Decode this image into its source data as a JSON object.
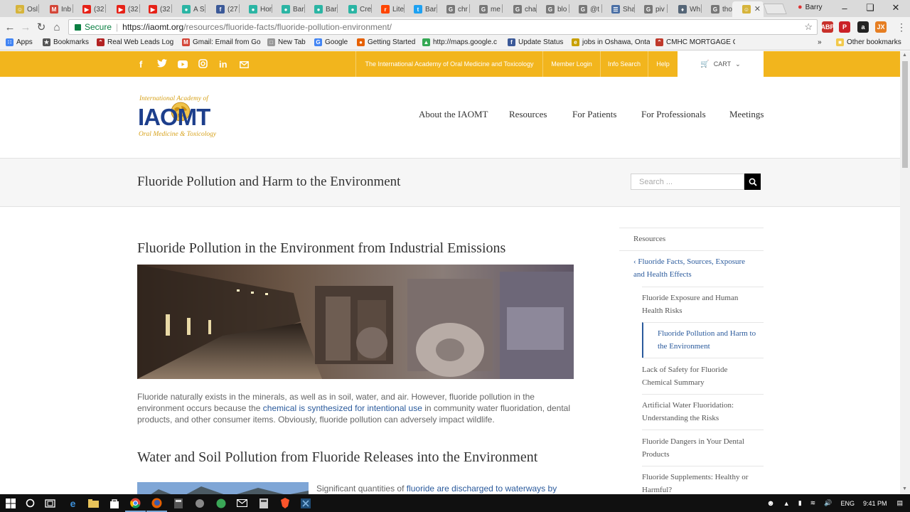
{
  "browser": {
    "tabs": [
      {
        "label": "Osl",
        "icon": "smiley-icon",
        "color": "#d6b43b"
      },
      {
        "label": "Inb",
        "icon": "gmail-icon",
        "color": "#d44638"
      },
      {
        "label": "(32",
        "icon": "youtube-icon",
        "color": "#e62117"
      },
      {
        "label": "(32",
        "icon": "youtube-icon",
        "color": "#e62117"
      },
      {
        "label": "(32",
        "icon": "youtube-icon",
        "color": "#e62117"
      },
      {
        "label": "A S",
        "icon": "site-icon",
        "color": "#2bb5a4"
      },
      {
        "label": "(27",
        "icon": "facebook-icon",
        "color": "#3b5998"
      },
      {
        "label": "Hor",
        "icon": "site-icon",
        "color": "#2bb5a4"
      },
      {
        "label": "Bar",
        "icon": "site-icon",
        "color": "#2bb5a4"
      },
      {
        "label": "Bar",
        "icon": "site-icon",
        "color": "#2bb5a4"
      },
      {
        "label": "Cre",
        "icon": "site-icon",
        "color": "#2bb5a4"
      },
      {
        "label": "Lite",
        "icon": "reddit-icon",
        "color": "#ff4500"
      },
      {
        "label": "Bar",
        "icon": "twitter-icon",
        "color": "#1da1f2"
      },
      {
        "label": "chr",
        "icon": "google-icon",
        "color": "#777777"
      },
      {
        "label": "me",
        "icon": "google-icon",
        "color": "#777777"
      },
      {
        "label": "cha",
        "icon": "google-icon",
        "color": "#777777"
      },
      {
        "label": "blo",
        "icon": "google-icon",
        "color": "#777777"
      },
      {
        "label": "@t",
        "icon": "google-icon",
        "color": "#777777"
      },
      {
        "label": "Sha",
        "icon": "document-icon",
        "color": "#4a6fa5"
      },
      {
        "label": "piv",
        "icon": "google-icon",
        "color": "#777777"
      },
      {
        "label": "Wh",
        "icon": "shield-icon",
        "color": "#556677"
      },
      {
        "label": "tho",
        "icon": "google-icon",
        "color": "#777777"
      },
      {
        "label": "",
        "icon": "smiley-icon",
        "color": "#d6b43b"
      }
    ],
    "profile_name": "Barry",
    "url_secure_label": "Secure",
    "url_host": "https://iaomt.org",
    "url_path": "/resources/fluoride-facts/fluoride-pollution-environment/",
    "extensions": [
      {
        "label": "ABP",
        "color": "#c8302a"
      },
      {
        "label": "P",
        "color": "#cb2027"
      },
      {
        "label": "a",
        "color": "#222222"
      },
      {
        "label": "JX",
        "color": "#e67e22"
      }
    ],
    "bookmarks": [
      {
        "label": "Apps",
        "icon": "apps-icon",
        "color": "#4285f4"
      },
      {
        "label": "Bookmarks",
        "icon": "star-icon",
        "color": "#555555"
      },
      {
        "label": "Real Web Leads Log",
        "icon": "site-icon",
        "color": "#b22222"
      },
      {
        "label": "Gmail: Email from Go",
        "icon": "gmail-icon",
        "color": "#d44638"
      },
      {
        "label": "New Tab",
        "icon": "document-icon",
        "color": "#999999"
      },
      {
        "label": "Google",
        "icon": "google-icon",
        "color": "#4285f4"
      },
      {
        "label": "Getting Started",
        "icon": "firefox-icon",
        "color": "#e66000"
      },
      {
        "label": "http://maps.google.c",
        "icon": "maps-icon",
        "color": "#34a853"
      },
      {
        "label": "Update Status",
        "icon": "facebook-icon",
        "color": "#3b5998"
      },
      {
        "label": "jobs in Oshawa, Onta",
        "icon": "ie-icon",
        "color": "#c8a000"
      },
      {
        "label": "CMHC MORTGAGE C",
        "icon": "site-icon",
        "color": "#c0392b"
      },
      {
        "label": "Other bookmarks",
        "icon": "folder-icon",
        "color": "#f2c94c"
      }
    ]
  },
  "site": {
    "topbar_links": [
      "The International Academy of Oral Medicine and Toxicology",
      "Member Login",
      "Info Search",
      "Help"
    ],
    "cart_label": "CART",
    "social": [
      "facebook-icon",
      "twitter-icon",
      "youtube-icon",
      "instagram-icon",
      "linkedin-icon",
      "email-icon"
    ],
    "logo": {
      "top": "International Academy of",
      "main": "IAOMT",
      "bottom": "Oral Medicine & Toxicology"
    },
    "nav": [
      "About the IAOMT",
      "Resources",
      "For Patients",
      "For Professionals",
      "Meetings"
    ],
    "page_title": "Fluoride Pollution and Harm to the Environment",
    "search_placeholder": "Search ...",
    "section1_title": "Fluoride Pollution in the Environment from Industrial Emissions",
    "para1": {
      "before": "Fluoride naturally exists in the minerals, as well as in soil, water, and air. However, fluoride pollution in the environment occurs because the ",
      "link": "chemical is synthesized for intentional use",
      "after": " in community water fluoridation, dental products, and other consumer items. Obviously, fluoride pollution can adversely impact wildlife."
    },
    "section2_title": "Water and Soil Pollution from Fluoride Releases into the Environment",
    "para2": {
      "before": "Significant quantities of ",
      "link": "fluoride are discharged to waterways by"
    },
    "sidebar": {
      "heading": "Resources",
      "parent": "‹ Fluoride Facts, Sources, Exposure and Health Effects",
      "items": [
        "Fluoride Exposure and Human Health Risks",
        "Fluoride Pollution and Harm to the Environment",
        "Lack of Safety for Fluoride Chemical Summary",
        "Artificial Water Fluoridation: Understanding the Risks",
        "Fluoride Dangers in Your Dental Products",
        "Fluoride Supplements: Healthy or Harmful?"
      ]
    }
  },
  "taskbar": {
    "language": "ENG",
    "time": "9:41 PM"
  },
  "colors": {
    "topbar": "#f2b51d",
    "link": "#2a5a9c"
  }
}
